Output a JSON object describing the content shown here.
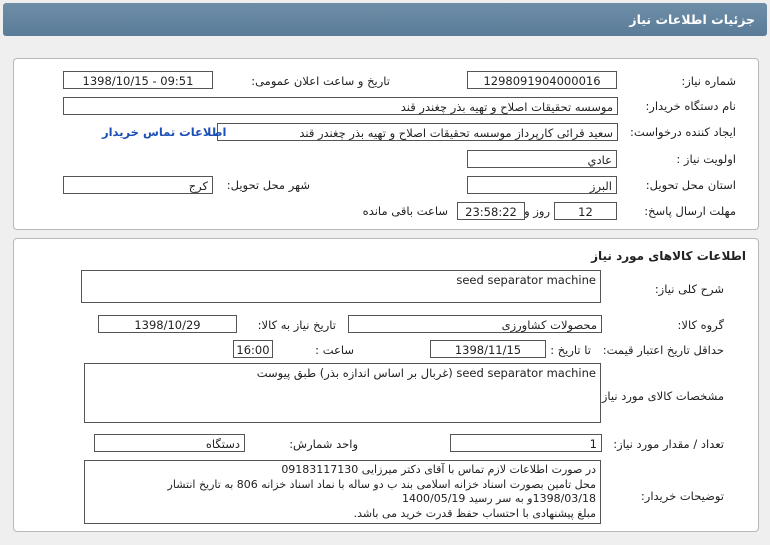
{
  "title": "جزئيات اطلاعات نياز",
  "need": {
    "need_number_label": "شماره نیاز:",
    "need_number": "1298091904000016",
    "announce_label": "تاریخ و ساعت اعلان عمومی:",
    "announce_value": "1398/10/15 - 09:51",
    "buyer_label": "نام دستگاه خریدار:",
    "buyer_value": "موسسه تحقیقات اصلاح و تهیه بذر چغندر قند",
    "creator_label": "ایجاد کننده درخواست:",
    "creator_value": "سعید قرائی کارپرداز موسسه تحقیقات اصلاح و تهیه بذر چغندر قند",
    "contact_link": "اطلاعات تماس خریدار",
    "priority_label": "اولویت نیاز :",
    "priority_value": "عادي",
    "province_label": "استان محل تحویل:",
    "province_value": "البرز",
    "city_label": "شهر محل تحویل:",
    "city_value": "کرج",
    "deadline_label": "مهلت ارسال پاسخ:",
    "deadline_days": "12",
    "day_word": "روز و",
    "deadline_time": "23:58:22",
    "remaining_word": "ساعت باقی مانده"
  },
  "goods": {
    "section_title": "اطلاعات کالاهای مورد نیاز",
    "desc_label": "شرح کلی نیاز:",
    "desc_value": "seed separator machine",
    "group_label": "گروه کالا:",
    "group_value": "محصولات کشاورزی",
    "need_date_label": "تاریخ نیاز به کالا:",
    "need_date_value": "1398/10/29",
    "validity_label": "حداقل تاریخ اعتبار قیمت:",
    "until_label": "تا تاریخ :",
    "validity_date": "1398/11/15",
    "time_label": "ساعت :",
    "validity_time": "16:00",
    "spec_label": "مشخصات کالای مورد نیاز:",
    "spec_value": "seed separator machine (غربال بر اساس اندازه بذر) طبق پیوست",
    "qty_label": "تعداد / مقدار مورد نیاز:",
    "qty_value": "1",
    "unit_label": "واحد شمارش:",
    "unit_value": "دستگاه",
    "notes_label": "توضیحات خریدار:",
    "notes_lines": [
      "در صورت اطلاعات لازم تماس با آقای دکتر میرزایی        09183117130",
      "محل تامین بصورت اسناد خزانه اسلامی بند ب دو ساله با نماد اسناد خزانه 806 به تاریخ انتشار",
      "1398/03/18و به سر رسید 1400/05/19",
      "مبلغ پیشنهادی با احتساب حفظ قدرت خرید می باشد."
    ]
  }
}
